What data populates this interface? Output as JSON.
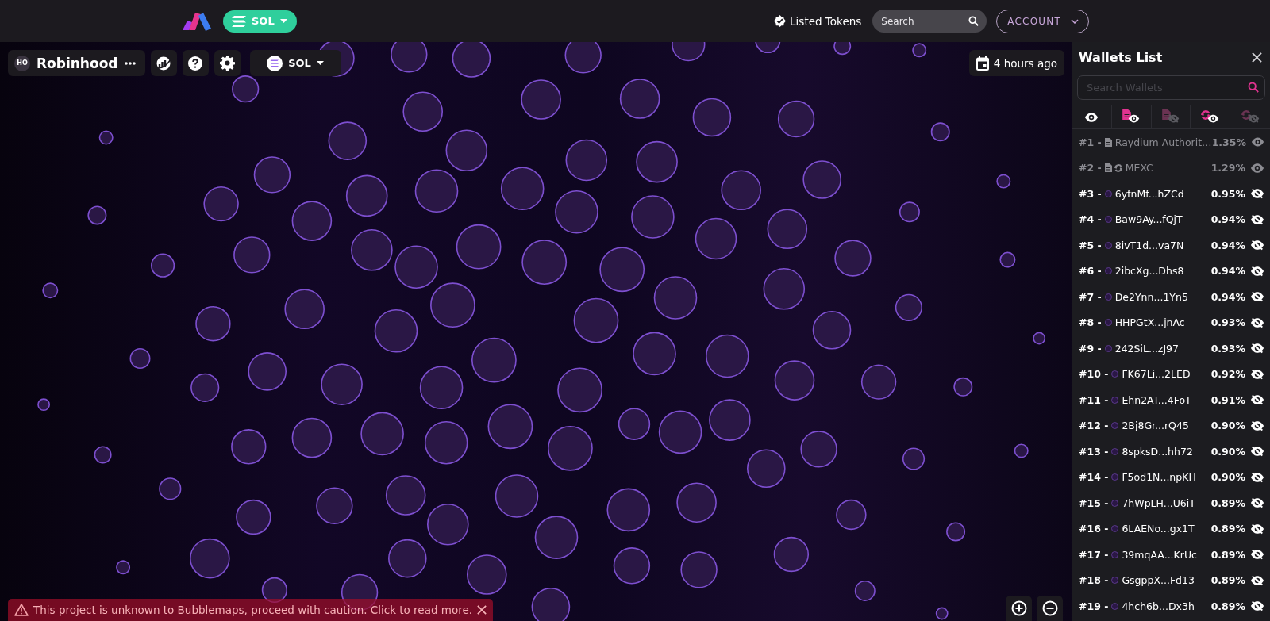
{
  "topbar": {
    "network": "SOL",
    "listed_tokens": "Listed Tokens",
    "search": {
      "placeholder": "Search"
    },
    "account": "ACCOUNT"
  },
  "map_toolbar": {
    "avatar": "HO",
    "token": "Robinhood",
    "network": "SOL",
    "updated": "4 hours ago"
  },
  "warning": "This project is unknown to Bubblemaps, proceed with caution. Click to read more.",
  "wallets_panel": {
    "title": "Wallets List",
    "search": {
      "placeholder": "Search Wallets"
    },
    "filters": [
      {
        "kind": "all",
        "hidden": false
      },
      {
        "kind": "contracts",
        "hidden": false
      },
      {
        "kind": "contracts",
        "hidden": true
      },
      {
        "kind": "exchanges",
        "hidden": false
      },
      {
        "kind": "exchanges",
        "hidden": true
      }
    ],
    "wallets": [
      {
        "rank": "#1 -",
        "kind": "contract",
        "name": "Raydium Authorit…",
        "percent": "1.35%",
        "hidden": false
      },
      {
        "rank": "#2 -",
        "kind": "exchange",
        "name": "MEXC",
        "percent": "1.29%",
        "hidden": false
      },
      {
        "rank": "#3 -",
        "kind": "wallet",
        "name": "6yfnMf...hZCd",
        "percent": "0.95%",
        "hidden": true
      },
      {
        "rank": "#4 -",
        "kind": "wallet",
        "name": "Baw9Ay...fQjT",
        "percent": "0.94%",
        "hidden": true
      },
      {
        "rank": "#5 -",
        "kind": "wallet",
        "name": "8ivT1d...va7N",
        "percent": "0.94%",
        "hidden": true
      },
      {
        "rank": "#6 -",
        "kind": "wallet",
        "name": "2ibcXg...Dhs8",
        "percent": "0.94%",
        "hidden": true
      },
      {
        "rank": "#7 -",
        "kind": "wallet",
        "name": "De2Ynn...1Yn5",
        "percent": "0.94%",
        "hidden": true
      },
      {
        "rank": "#8 -",
        "kind": "wallet",
        "name": "HHPGtX...jnAc",
        "percent": "0.93%",
        "hidden": true
      },
      {
        "rank": "#9 -",
        "kind": "wallet",
        "name": "242SiL...zJ97",
        "percent": "0.93%",
        "hidden": true
      },
      {
        "rank": "#10 -",
        "kind": "wallet",
        "name": "FK67Li...2LED",
        "percent": "0.92%",
        "hidden": true
      },
      {
        "rank": "#11 -",
        "kind": "wallet",
        "name": "Ehn2AT...4FoT",
        "percent": "0.91%",
        "hidden": true
      },
      {
        "rank": "#12 -",
        "kind": "wallet",
        "name": "2Bj8Gr...rQ45",
        "percent": "0.90%",
        "hidden": true
      },
      {
        "rank": "#13 -",
        "kind": "wallet",
        "name": "8spksD...hh72",
        "percent": "0.90%",
        "hidden": true
      },
      {
        "rank": "#14 -",
        "kind": "wallet",
        "name": "F5od1N...npKH",
        "percent": "0.90%",
        "hidden": true
      },
      {
        "rank": "#15 -",
        "kind": "wallet",
        "name": "7hWpLH...U6iT",
        "percent": "0.89%",
        "hidden": true
      },
      {
        "rank": "#16 -",
        "kind": "wallet",
        "name": "6LAENo...gx1T",
        "percent": "0.89%",
        "hidden": true
      },
      {
        "rank": "#17 -",
        "kind": "wallet",
        "name": "39mqAA...KrUc",
        "percent": "0.89%",
        "hidden": true
      },
      {
        "rank": "#18 -",
        "kind": "wallet",
        "name": "GsgppX...Fd13",
        "percent": "0.89%",
        "hidden": true
      },
      {
        "rank": "#19 -",
        "kind": "wallet",
        "name": "4hch6b...Dx3h",
        "percent": "0.89%",
        "hidden": true
      }
    ]
  }
}
